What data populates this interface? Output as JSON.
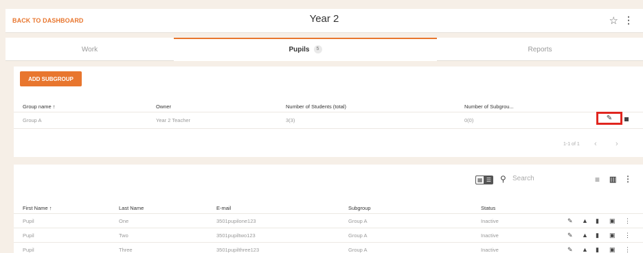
{
  "header": {
    "back_label": "BACK TO DASHBOARD",
    "title": "Year 2"
  },
  "tabs": [
    {
      "label": "Work"
    },
    {
      "label": "Pupils",
      "badge": "5"
    },
    {
      "label": "Reports"
    }
  ],
  "groups": {
    "add_button": "ADD SUBGROUP",
    "columns": [
      "Group name ↑",
      "Owner",
      "Number of Students (total)",
      "Number of Subgrou..."
    ],
    "rows": [
      {
        "name": "Group A",
        "owner": "Year 2 Teacher",
        "students": "3(3)",
        "subgroups": "0(0)"
      }
    ],
    "pager": "1-1 of 1"
  },
  "pupils": {
    "search_placeholder": "Search",
    "columns": [
      "First Name ↑",
      "Last Name",
      "E-mail",
      "Subgroup",
      "Status"
    ],
    "rows": [
      {
        "first": "Pupil",
        "last": "One",
        "email": "3501pupilone123",
        "subgroup": "Group A",
        "status": "Inactive"
      },
      {
        "first": "Pupil",
        "last": "Two",
        "email": "3501pupiltwo123",
        "subgroup": "Group A",
        "status": "Inactive"
      },
      {
        "first": "Pupil",
        "last": "Three",
        "email": "3501pupilthree123",
        "subgroup": "Group A",
        "status": "Inactive"
      }
    ]
  },
  "colors": {
    "accent": "#e8762e",
    "highlight": "#e0261f"
  },
  "icons": [
    "star-icon",
    "more-vert-icon",
    "pencil-icon",
    "trash-icon",
    "chevron-left-icon",
    "chevron-right-icon",
    "grid-view-icon",
    "list-view-icon",
    "search-icon",
    "filter-icon",
    "columns-icon",
    "graduation-cap-icon",
    "bar-chart-icon",
    "message-icon"
  ]
}
